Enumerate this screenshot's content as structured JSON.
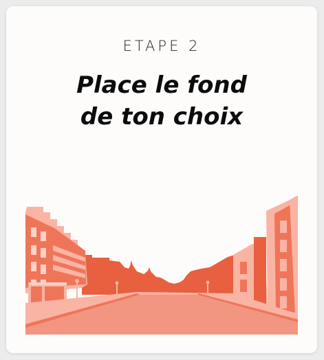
{
  "card": {
    "step_label": "ETAPE 2",
    "title_line1": "Place le fond",
    "title_line2": "de ton choix"
  },
  "illustration": {
    "name": "street-scene",
    "colors": {
      "light": "#f9b4a4",
      "mid": "#ef7559",
      "dark": "#e8603f",
      "road": "#f29681"
    }
  }
}
